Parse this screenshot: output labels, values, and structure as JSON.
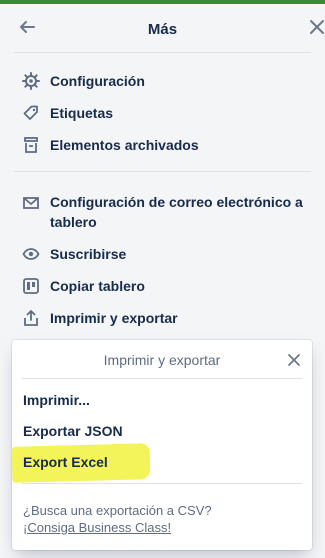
{
  "header": {
    "title": "Más"
  },
  "menu": {
    "group1": [
      {
        "label": "Configuración",
        "icon": "gear-icon"
      },
      {
        "label": "Etiquetas",
        "icon": "tag-icon"
      },
      {
        "label": "Elementos archivados",
        "icon": "archive-icon"
      }
    ],
    "group2": [
      {
        "label": "Configuración de correo electrónico a tablero",
        "icon": "mail-icon"
      },
      {
        "label": "Suscribirse",
        "icon": "eye-icon"
      },
      {
        "label": "Copiar tablero",
        "icon": "board-icon"
      },
      {
        "label": "Imprimir y exportar",
        "icon": "share-icon"
      }
    ]
  },
  "popover": {
    "title": "Imprimir y exportar",
    "items": [
      "Imprimir...",
      "Exportar JSON",
      "Export Excel"
    ],
    "note": "¿Busca una exportación a CSV?",
    "link": "¡Consiga Business Class!",
    "highlight_color": "#f3f35a"
  },
  "colors": {
    "panel_bg": "#f4f5f7",
    "text": "#172b4d",
    "muted": "#5e6c84",
    "top_strip": "#3a8a3a"
  }
}
